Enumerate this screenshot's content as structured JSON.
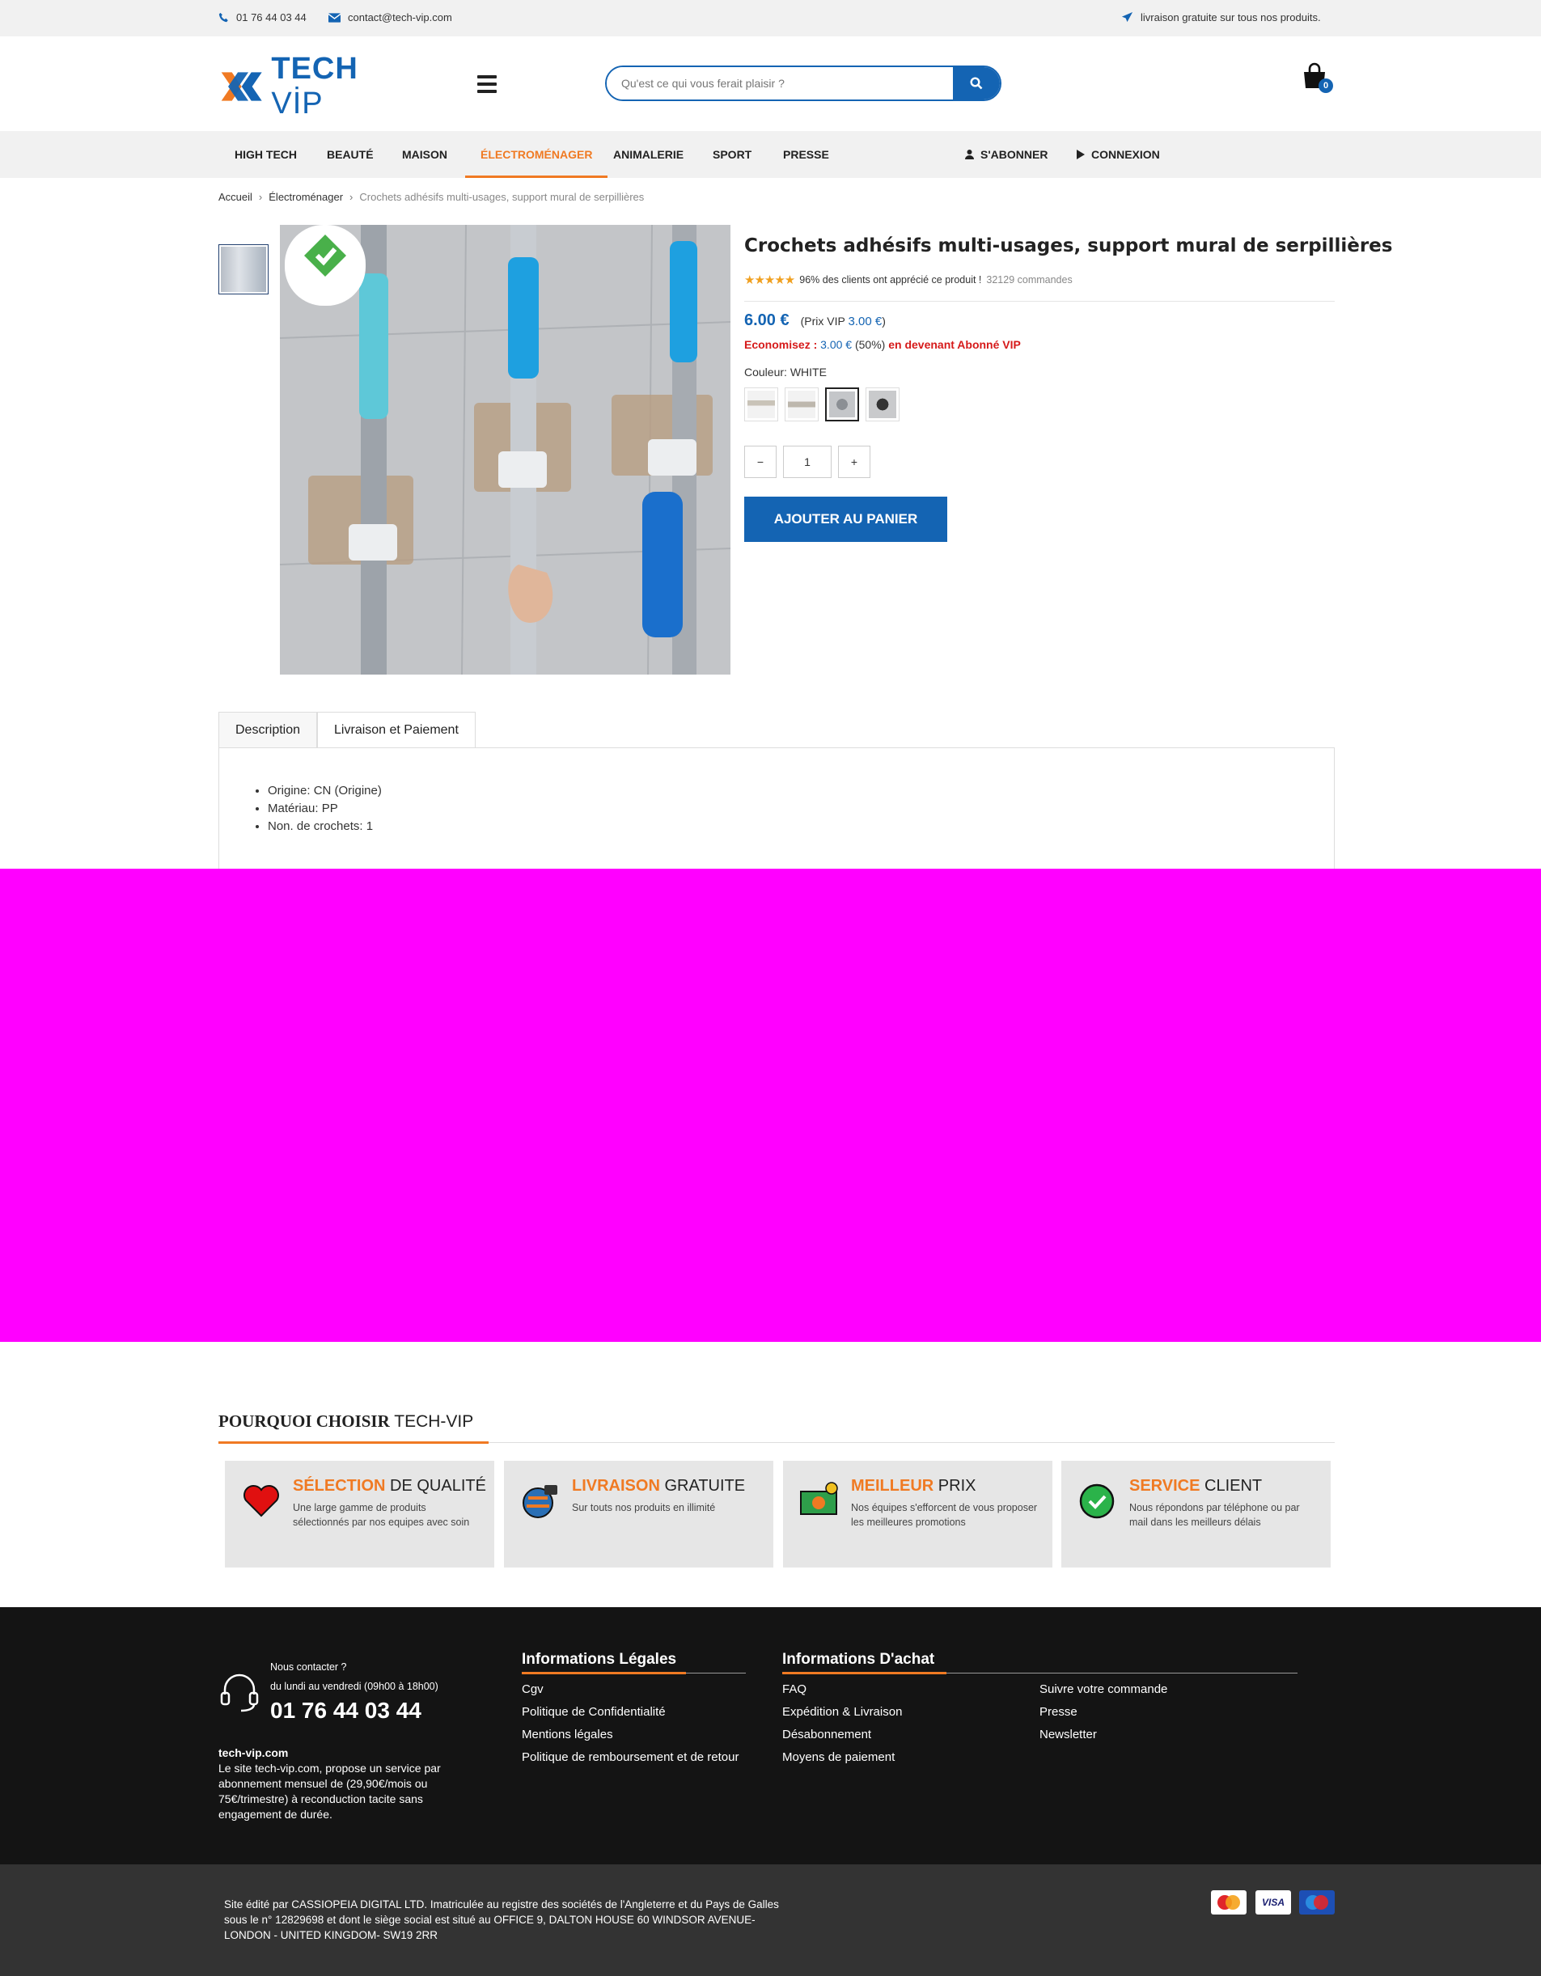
{
  "topbar": {
    "phone": "01 76 44 03 44",
    "email": "contact@tech-vip.com",
    "shipping": "livraison gratuite sur tous nos produits."
  },
  "header": {
    "logo_text": "TECH",
    "logo_vip": "VİP",
    "search_placeholder": "Qu'est ce qui vous ferait plaisir ?",
    "cart_count": "0"
  },
  "nav": {
    "items": [
      "HIGH TECH",
      "BEAUTÉ",
      "MAISON",
      "ÉLECTROMÉNAGER",
      "ANIMALERIE",
      "SPORT",
      "PRESSE"
    ],
    "subscribe": "S'ABONNER",
    "login": "CONNEXION"
  },
  "breadcrumb": {
    "home": "Accueil",
    "category": "Électroménager",
    "current": "Crochets adhésifs multi-usages, support mural de serpillières"
  },
  "product": {
    "title": "Crochets adhésifs multi-usages, support mural de serpillières",
    "rating_text": "96% des clients ont apprécié ce produit !",
    "orders": "32129 commandes",
    "price": "6.00 €",
    "vip_prefix": "(Prix VIP",
    "vip_price": "3.00 €",
    "vip_suffix": ")",
    "save_prefix": "Economisez :",
    "save_amount": "3.00 €",
    "save_percent": "(50%)",
    "save_suffix": "en devenant Abonné VIP",
    "color_label": "Couleur:",
    "color_value": "WHITE",
    "quantity": "1",
    "qty_minus": "−",
    "qty_plus": "+",
    "add_to_cart": "AJOUTER AU PANIER"
  },
  "tabs": {
    "description": "Description",
    "shipping": "Livraison et Paiement",
    "items": [
      "Origine: CN (Origine)",
      "Matériau: PP",
      "Non. de crochets: 1"
    ]
  },
  "why": {
    "title_serif": "POURQUOI CHOISIR",
    "title_light": "TECH-VIP",
    "cards": [
      {
        "highlight": "SÉLECTION",
        "rest": "DE QUALITÉ",
        "desc": "Une large gamme de produits sélectionnés par nos equipes avec soin"
      },
      {
        "highlight": "LIVRAISON",
        "rest": "GRATUITE",
        "desc": "Sur touts nos produits en illimité"
      },
      {
        "highlight": "MEILLEUR",
        "rest": "PRIX",
        "desc": "Nos équipes s'efforcent de vous proposer les meilleures promotions"
      },
      {
        "highlight": "SERVICE",
        "rest": "CLIENT",
        "desc": "Nous répondons par téléphone ou par mail dans les meilleurs délais"
      }
    ]
  },
  "footer": {
    "contact_label": "Nous contacter ?",
    "hours": "du lundi au vendredi (09h00 à 18h00)",
    "phone": "01 76 44 03 44",
    "site_name": "tech-vip.com",
    "about": "Le site tech-vip.com, propose un service par abonnement mensuel de (29,90€/mois ou 75€/trimestre) à reconduction tacite sans engagement de durée.",
    "legal_title": "Informations Légales",
    "legal_links": [
      "Cgv",
      "Politique de Confidentialité",
      "Mentions légales",
      "Politique de remboursement et de retour"
    ],
    "purchase_title": "Informations D'achat",
    "purchase_links_1": [
      "FAQ",
      "Expédition & Livraison",
      "Désabonnement",
      "Moyens de paiement"
    ],
    "purchase_links_2": [
      "Suivre votre commande",
      "Presse",
      "Newsletter"
    ],
    "legal_notice": "Site édité par CASSIOPEIA DIGITAL LTD. Imatriculée au registre des sociétés de l'Angleterre et du Pays de Galles sous le n° 12829698 et dont le siège social est situé au OFFICE 9, DALTON HOUSE 60 WINDSOR AVENUE- LONDON - UNITED KINGDOM- SW19 2RR",
    "payments": [
      "MasterCard",
      "VISA",
      "Maestro"
    ]
  },
  "colors": {
    "primary": "#1464b3",
    "accent": "#f07a23",
    "sale": "#d61a1a"
  }
}
